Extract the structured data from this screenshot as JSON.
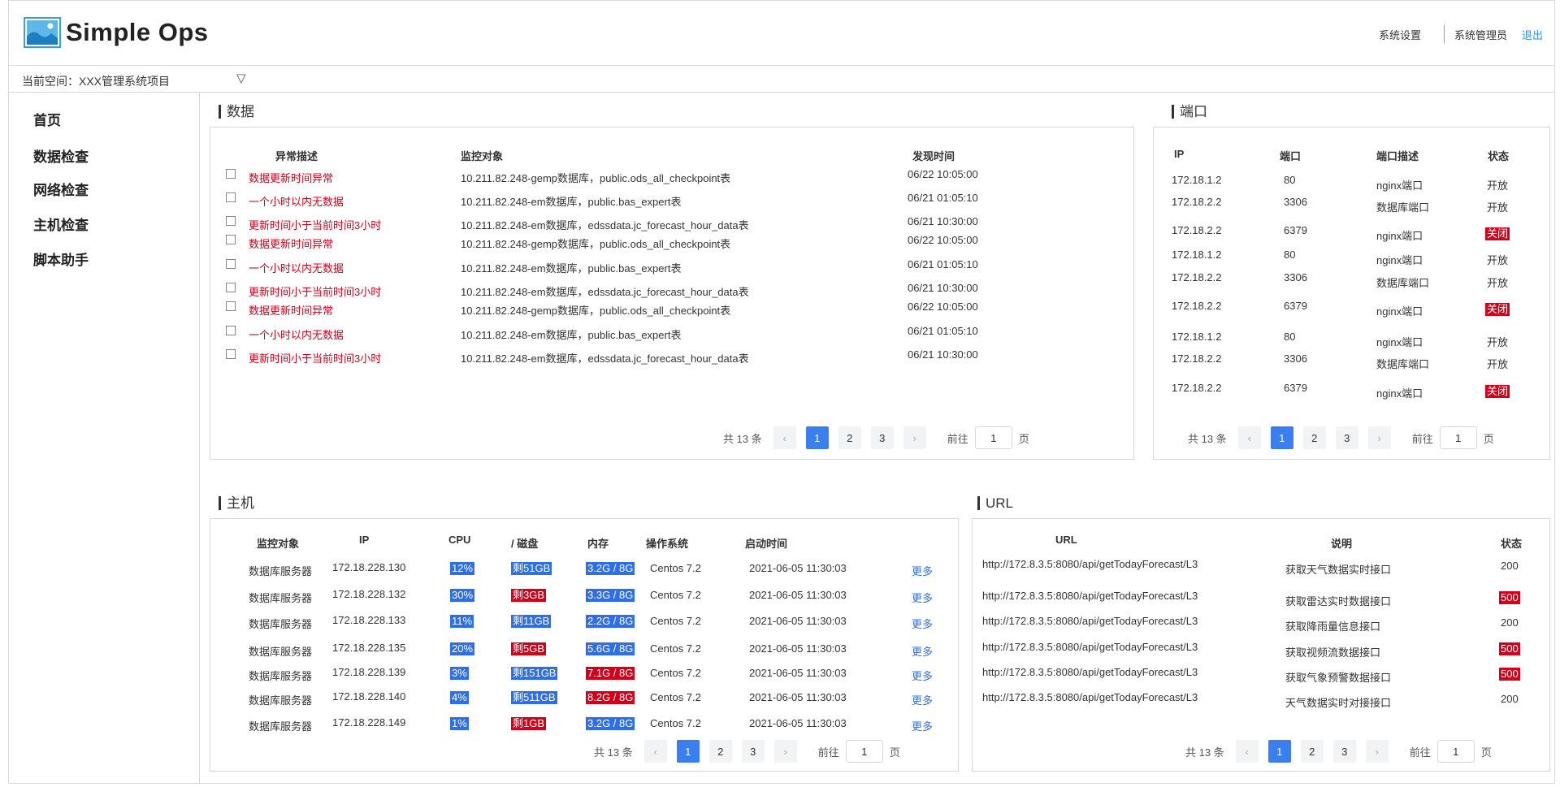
{
  "app": {
    "title": "Simple Ops"
  },
  "topbar": {
    "settings": "系统设置",
    "user": "系统管理员",
    "logout": "退出"
  },
  "workspace": {
    "label": "当前空间：XXX管理系统项目",
    "caret": "▽"
  },
  "sidebar": {
    "items": [
      "首页",
      "数据检查",
      "网络检查",
      "主机检查",
      "脚本助手"
    ]
  },
  "data_section": {
    "title": "数据",
    "headers": [
      "异常描述",
      "监控对象",
      "发现时间"
    ],
    "rows": [
      {
        "desc": "数据更新时间异常",
        "target": "10.211.82.248-gemp数据库，public.ods_all_checkpoint表",
        "time": "06/22 10:05:00"
      },
      {
        "desc": "一个小时以内无数据",
        "target": "10.211.82.248-em数据库，public.bas_expert表",
        "time": "06/21 01:05:10"
      },
      {
        "desc": "更新时间小于当前时间3小时",
        "target": "10.211.82.248-em数据库，edssdata.jc_forecast_hour_data表",
        "time": "06/21 10:30:00"
      },
      {
        "desc": "数据更新时间异常",
        "target": "10.211.82.248-gemp数据库，public.ods_all_checkpoint表",
        "time": "06/22 10:05:00"
      },
      {
        "desc": "一个小时以内无数据",
        "target": "10.211.82.248-em数据库，public.bas_expert表",
        "time": "06/21 01:05:10"
      },
      {
        "desc": "更新时间小于当前时间3小时",
        "target": "10.211.82.248-em数据库，edssdata.jc_forecast_hour_data表",
        "time": "06/21 10:30:00"
      },
      {
        "desc": "数据更新时间异常",
        "target": "10.211.82.248-gemp数据库，public.ods_all_checkpoint表",
        "time": "06/22 10:05:00"
      },
      {
        "desc": "一个小时以内无数据",
        "target": "10.211.82.248-em数据库，public.bas_expert表",
        "time": "06/21 01:05:10"
      },
      {
        "desc": "更新时间小于当前时间3小时",
        "target": "10.211.82.248-em数据库，edssdata.jc_forecast_hour_data表",
        "time": "06/21 10:30:00"
      }
    ],
    "pager": {
      "total": "共 13 条",
      "pages": [
        "1",
        "2",
        "3"
      ],
      "prev": "‹",
      "next": "›",
      "goto": "前往",
      "page_value": "1",
      "page_suffix": "页"
    }
  },
  "port_section": {
    "title": "端口",
    "headers": [
      "IP",
      "端口",
      "端口描述",
      "状态"
    ],
    "rows": [
      {
        "ip": "172.18.1.2",
        "port": "80",
        "desc": "nginx端口",
        "status": "开放",
        "closed": false
      },
      {
        "ip": "172.18.2.2",
        "port": "3306",
        "desc": "数据库端口",
        "status": "开放",
        "closed": false
      },
      {
        "ip": "172.18.2.2",
        "port": "6379",
        "desc": "nginx端口",
        "status": "关闭",
        "closed": true
      },
      {
        "ip": "172.18.1.2",
        "port": "80",
        "desc": "nginx端口",
        "status": "开放",
        "closed": false
      },
      {
        "ip": "172.18.2.2",
        "port": "3306",
        "desc": "数据库端口",
        "status": "开放",
        "closed": false
      },
      {
        "ip": "172.18.2.2",
        "port": "6379",
        "desc": "nginx端口",
        "status": "关闭",
        "closed": true
      },
      {
        "ip": "172.18.1.2",
        "port": "80",
        "desc": "nginx端口",
        "status": "开放",
        "closed": false
      },
      {
        "ip": "172.18.2.2",
        "port": "3306",
        "desc": "数据库端口",
        "status": "开放",
        "closed": false
      },
      {
        "ip": "172.18.2.2",
        "port": "6379",
        "desc": "nginx端口",
        "status": "关闭",
        "closed": true
      }
    ],
    "pager": {
      "total": "共 13 条",
      "pages": [
        "1",
        "2",
        "3"
      ],
      "prev": "‹",
      "next": "›",
      "goto": "前往",
      "page_value": "1",
      "page_suffix": "页"
    }
  },
  "host_section": {
    "title": "主机",
    "headers": [
      "监控对象",
      "IP",
      "CPU",
      "/ 磁盘",
      "内存",
      "操作系统",
      "启动时间"
    ],
    "more_label": "更多",
    "rows": [
      {
        "target": "数据库服务器",
        "ip": "172.18.228.130",
        "cpu": "12%",
        "disk": "剩51GB",
        "disk_alert": false,
        "mem": "3.2G / 8G",
        "mem_alert": false,
        "os": "Centos 7.2",
        "boot": "2021-06-05 11:30:03"
      },
      {
        "target": "数据库服务器",
        "ip": "172.18.228.132",
        "cpu": "30%",
        "disk": "剩3GB",
        "disk_alert": true,
        "mem": "3.3G / 8G",
        "mem_alert": false,
        "os": "Centos 7.2",
        "boot": "2021-06-05 11:30:03"
      },
      {
        "target": "数据库服务器",
        "ip": "172.18.228.133",
        "cpu": "11%",
        "disk": "剩11GB",
        "disk_alert": false,
        "mem": "2.2G / 8G",
        "mem_alert": false,
        "os": "Centos 7.2",
        "boot": "2021-06-05 11:30:03"
      },
      {
        "target": "数据库服务器",
        "ip": "172.18.228.135",
        "cpu": "20%",
        "disk": "剩5GB",
        "disk_alert": true,
        "mem": "5.6G / 8G",
        "mem_alert": false,
        "os": "Centos 7.2",
        "boot": "2021-06-05 11:30:03"
      },
      {
        "target": "数据库服务器",
        "ip": "172.18.228.139",
        "cpu": "3%",
        "disk": "剩151GB",
        "disk_alert": false,
        "mem": "7.1G / 8G",
        "mem_alert": true,
        "os": "Centos 7.2",
        "boot": "2021-06-05 11:30:03"
      },
      {
        "target": "数据库服务器",
        "ip": "172.18.228.140",
        "cpu": "4%",
        "disk": "剩511GB",
        "disk_alert": false,
        "mem": "8.2G / 8G",
        "mem_alert": true,
        "os": "Centos 7.2",
        "boot": "2021-06-05 11:30:03"
      },
      {
        "target": "数据库服务器",
        "ip": "172.18.228.149",
        "cpu": "1%",
        "disk": "剩1GB",
        "disk_alert": true,
        "mem": "3.2G / 8G",
        "mem_alert": false,
        "os": "Centos 7.2",
        "boot": "2021-06-05 11:30:03"
      }
    ],
    "pager": {
      "total": "共 13 条",
      "pages": [
        "1",
        "2",
        "3"
      ],
      "prev": "‹",
      "next": "›",
      "goto": "前往",
      "page_value": "1",
      "page_suffix": "页"
    }
  },
  "url_section": {
    "title": "URL",
    "headers": [
      "URL",
      "说明",
      "状态"
    ],
    "rows": [
      {
        "url": "http://172.8.3.5:8080/api/getTodayForecast/L3",
        "desc": "获取天气数据实时接口",
        "status": "200",
        "alert": false
      },
      {
        "url": "http://172.8.3.5:8080/api/getTodayForecast/L3",
        "desc": "获取雷达实时数据接口",
        "status": "500",
        "alert": true
      },
      {
        "url": "http://172.8.3.5:8080/api/getTodayForecast/L3",
        "desc": "获取降雨量信息接口",
        "status": "200",
        "alert": false
      },
      {
        "url": "http://172.8.3.5:8080/api/getTodayForecast/L3",
        "desc": "获取视频流数据接口",
        "status": "500",
        "alert": true
      },
      {
        "url": "http://172.8.3.5:8080/api/getTodayForecast/L3",
        "desc": "获取气象预警数据接口",
        "status": "500",
        "alert": true
      },
      {
        "url": "http://172.8.3.5:8080/api/getTodayForecast/L3",
        "desc": "天气数据实时对接接口",
        "status": "200",
        "alert": false
      }
    ],
    "pager": {
      "total": "共 13 条",
      "pages": [
        "1",
        "2",
        "3"
      ],
      "prev": "‹",
      "next": "›",
      "goto": "前往",
      "page_value": "1",
      "page_suffix": "页"
    }
  },
  "colors": {
    "accent": "#3a7ef0",
    "alert": "#d0021b",
    "badge_blue": "#2f6fe6",
    "link": "#2f8fe0"
  },
  "icons": {
    "logo": "image-logo-icon",
    "dropdown": "caret-down-icon",
    "checkbox": "checkbox-icon"
  }
}
